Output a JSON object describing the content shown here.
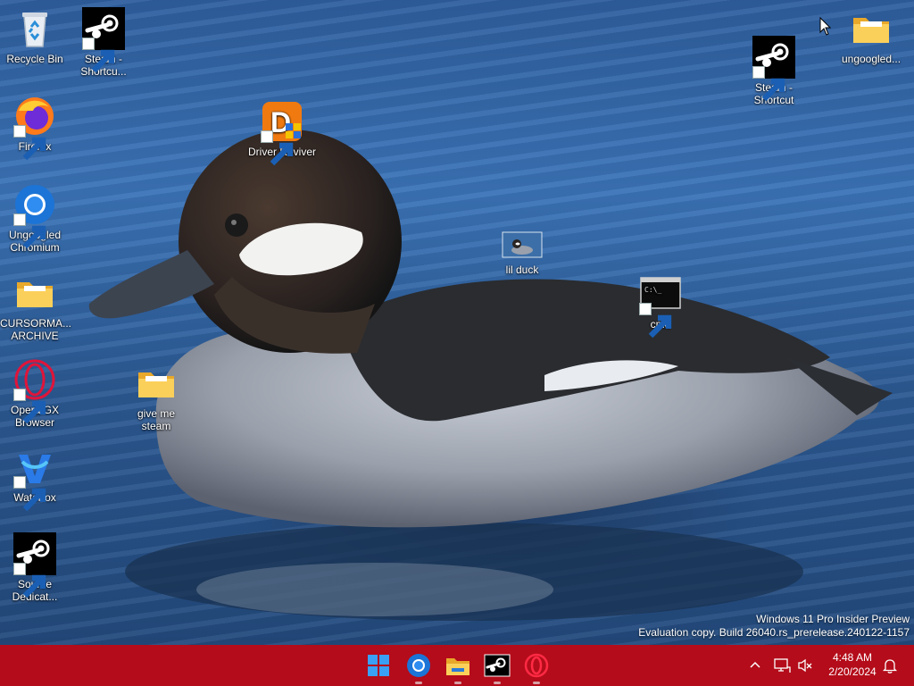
{
  "desktop": {
    "icons": [
      {
        "label": "Recycle Bin",
        "icon": "recycle-bin-icon"
      },
      {
        "label": "Steam - Shortcu...",
        "icon": "steam-icon"
      },
      {
        "label": "Firefox",
        "icon": "firefox-icon"
      },
      {
        "label": "Driver Reviver",
        "icon": "driver-reviver-icon"
      },
      {
        "label": "Ungoogled Chromium",
        "icon": "chromium-icon"
      },
      {
        "label": "CURSORMA... ARCHIVE",
        "icon": "folder-icon"
      },
      {
        "label": "Opera GX Browser",
        "icon": "opera-gx-icon"
      },
      {
        "label": "give me steam",
        "icon": "folder-icon"
      },
      {
        "label": "Waterfox",
        "icon": "waterfox-icon"
      },
      {
        "label": "Source Dedicat...",
        "icon": "steam-icon"
      },
      {
        "label": "lil duck",
        "icon": "image-thumbnail-icon"
      },
      {
        "label": "cmd",
        "icon": "cmd-icon"
      },
      {
        "label": "Steam - Shortcut",
        "icon": "steam-icon"
      },
      {
        "label": "ungoogled...",
        "icon": "folder-icon"
      }
    ]
  },
  "watermark": {
    "line1": "Windows 11 Pro Insider Preview",
    "line2": "Evaluation copy. Build 26040.rs_prerelease.240122-1157"
  },
  "taskbar": {
    "color": "#b40c1a",
    "apps": [
      "start-icon",
      "chromium-icon",
      "file-explorer-icon",
      "steam-icon",
      "opera-gx-icon"
    ],
    "clock": {
      "time": "4:48 AM",
      "date": "2/20/2024"
    }
  }
}
